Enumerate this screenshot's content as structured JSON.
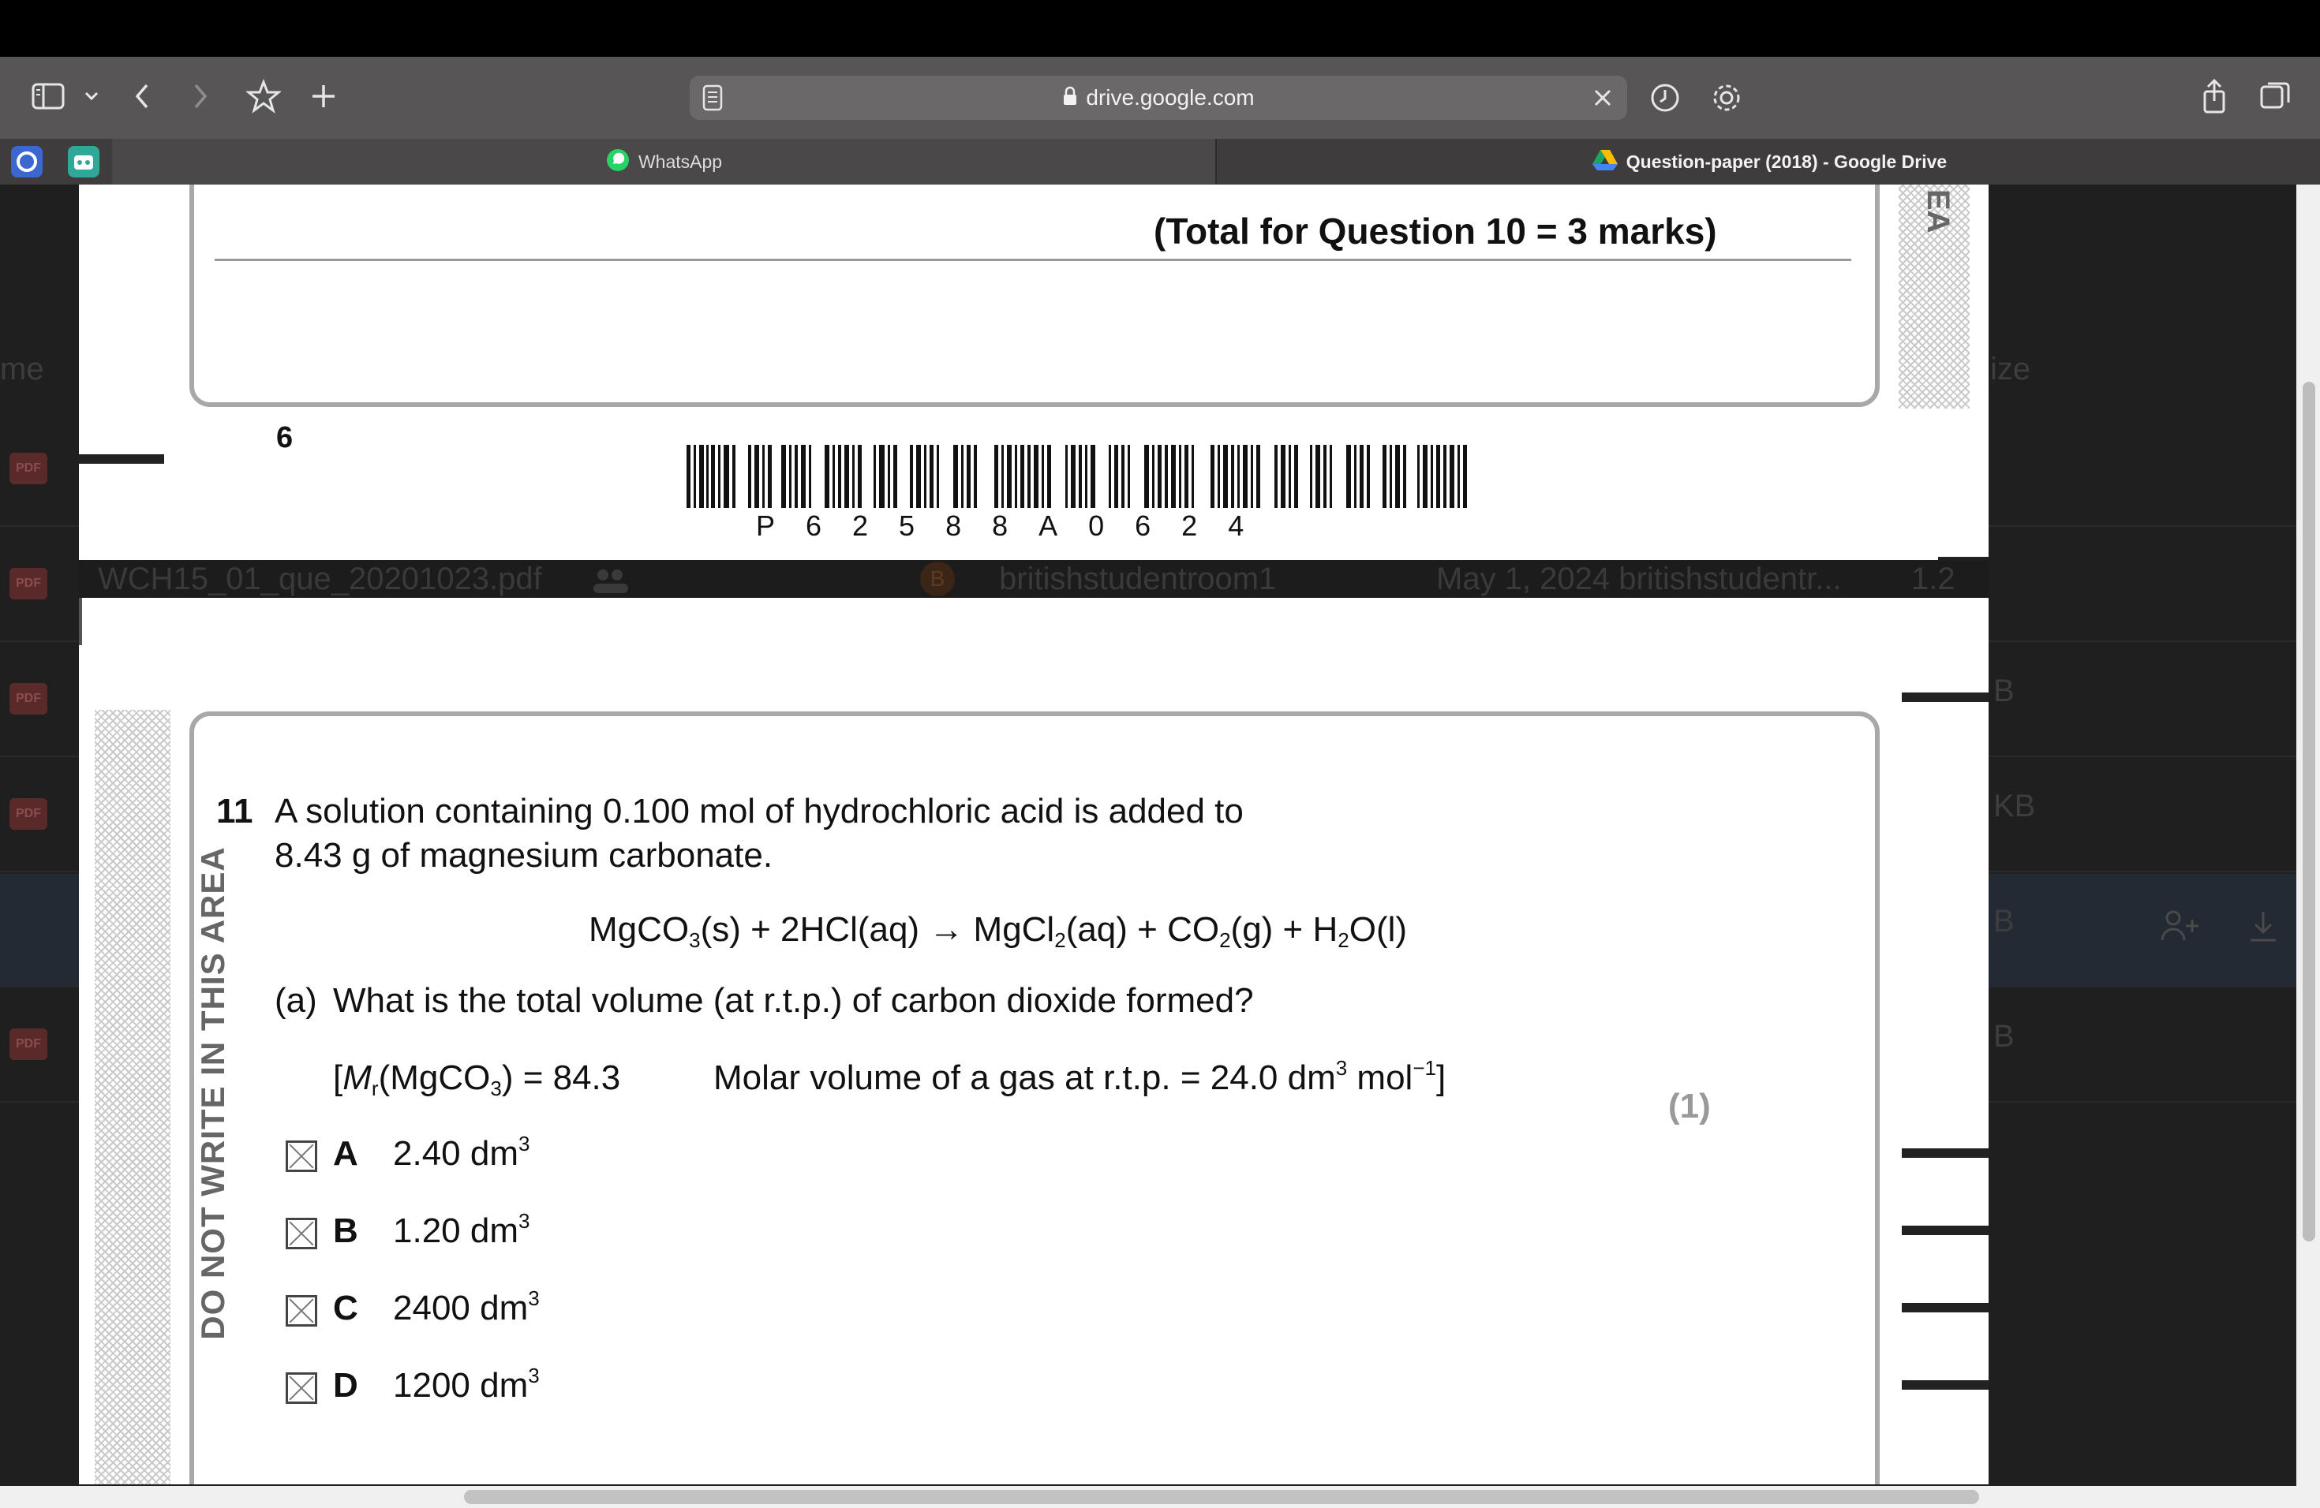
{
  "browser": {
    "url": "drive.google.com",
    "tabs": [
      {
        "label": "WhatsApp"
      },
      {
        "label": "Question-paper (2018) - Google Drive"
      }
    ]
  },
  "drive_background": {
    "file_name": "WCH15_01_que_20201023.pdf",
    "owner_initial": "B",
    "owner": "britishstudentroom1",
    "modified": "May 1, 2024 britishstudentr...",
    "size": "1.2 MB",
    "header_left": "me",
    "header_right": "ize",
    "pdf_chip": "PDF",
    "col_suffix_b": "B",
    "col_suffix_kb": "KB"
  },
  "page1": {
    "total_marks": "(Total for Question 10 = 3 marks)",
    "page_number": "6",
    "barcode_text": "P62588A0624",
    "margin_label": "EA"
  },
  "page2": {
    "margin_text": "DO NOT WRITE IN THIS AREA",
    "question_number": "11",
    "intro_line1": "A solution containing 0.100 mol of hydrochloric acid is added to",
    "intro_line2": "8.43 g of magnesium carbonate.",
    "part_label": "(a)",
    "part_text": "What is the total volume (at r.t.p.) of carbon dioxide formed?",
    "mark": "(1)",
    "options": [
      {
        "letter": "A",
        "value": "2.40 dm"
      },
      {
        "letter": "B",
        "value": "1.20 dm"
      },
      {
        "letter": "C",
        "value": "2400 dm"
      },
      {
        "letter": "D",
        "value": "1200 dm"
      }
    ]
  }
}
